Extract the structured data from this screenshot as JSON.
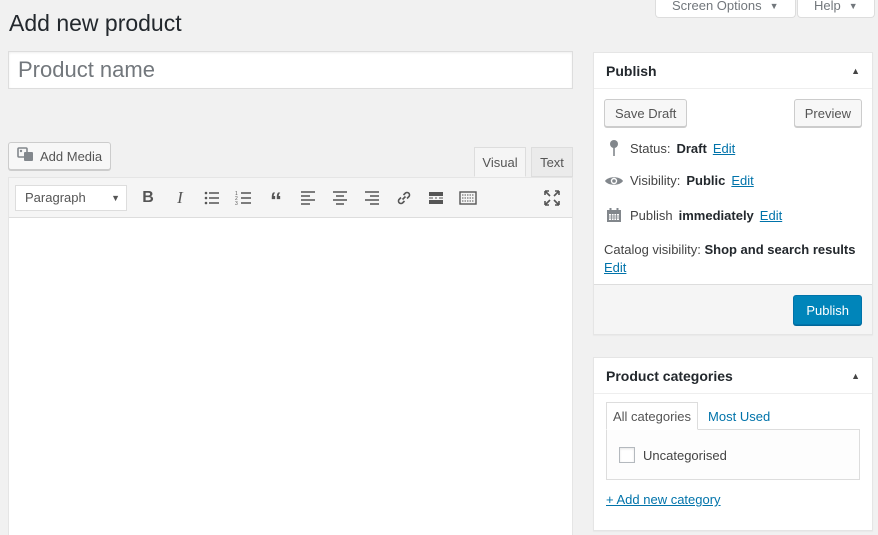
{
  "header": {
    "screen_options": "Screen Options",
    "help": "Help",
    "page_title": "Add new product"
  },
  "title_field": {
    "placeholder": "Product name",
    "value": ""
  },
  "editor": {
    "add_media": "Add Media",
    "tabs": [
      "Visual",
      "Text"
    ],
    "active_tab": "Visual",
    "format_select": "Paragraph",
    "toolbar_icons": [
      "bold-icon",
      "italic-icon",
      "bulleted-list-icon",
      "numbered-list-icon",
      "blockquote-icon",
      "align-left-icon",
      "align-center-icon",
      "align-right-icon",
      "link-icon",
      "read-more-icon",
      "toolbar-toggle-icon",
      "fullscreen-icon"
    ]
  },
  "publish": {
    "title": "Publish",
    "save_draft": "Save Draft",
    "preview": "Preview",
    "status_label": "Status:",
    "status_value": "Draft",
    "visibility_label": "Visibility:",
    "visibility_value": "Public",
    "publish_label": "Publish",
    "publish_value": "immediately",
    "catalog_label": "Catalog visibility:",
    "catalog_value": "Shop and search results",
    "edit": "Edit",
    "publish_button": "Publish"
  },
  "categories": {
    "title": "Product categories",
    "tabs": [
      "All categories",
      "Most Used"
    ],
    "items": [
      {
        "label": "Uncategorised",
        "checked": false
      }
    ],
    "add_new": "+ Add new category"
  },
  "colors": {
    "primary": "#0085ba",
    "link": "#0073aa",
    "background": "#f1f1f1"
  }
}
